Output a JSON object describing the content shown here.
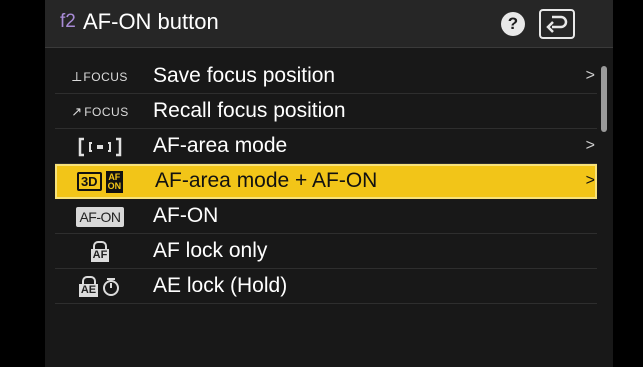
{
  "header": {
    "code": "f2",
    "title": "AF-ON button",
    "help_icon": "?",
    "back_icon": "return-arrow-icon"
  },
  "menu": {
    "items": [
      {
        "icon": "save-focus-icon",
        "icon_text": "FOCUS",
        "label": "Save focus position",
        "has_submenu": true
      },
      {
        "icon": "recall-focus-icon",
        "icon_text": "FOCUS",
        "label": "Recall focus position",
        "has_submenu": false
      },
      {
        "icon": "af-area-bracket-icon",
        "label": "AF-area mode",
        "has_submenu": true
      },
      {
        "icon": "af-area-afon-icon",
        "icon_text": "3D",
        "label": "AF-area mode + AF-ON",
        "has_submenu": true,
        "selected": true
      },
      {
        "icon": "af-on-icon",
        "icon_text": "AF-ON",
        "label": "AF-ON",
        "has_submenu": false
      },
      {
        "icon": "af-lock-icon",
        "icon_text": "AF",
        "label": "AF lock only",
        "has_submenu": false
      },
      {
        "icon": "ae-lock-hold-icon",
        "icon_text": "AE",
        "label": "AE lock (Hold)",
        "has_submenu": false
      }
    ],
    "chevron": ">"
  },
  "colors": {
    "selected_bg": "#f2c518",
    "code_color": "#a88bd6"
  }
}
